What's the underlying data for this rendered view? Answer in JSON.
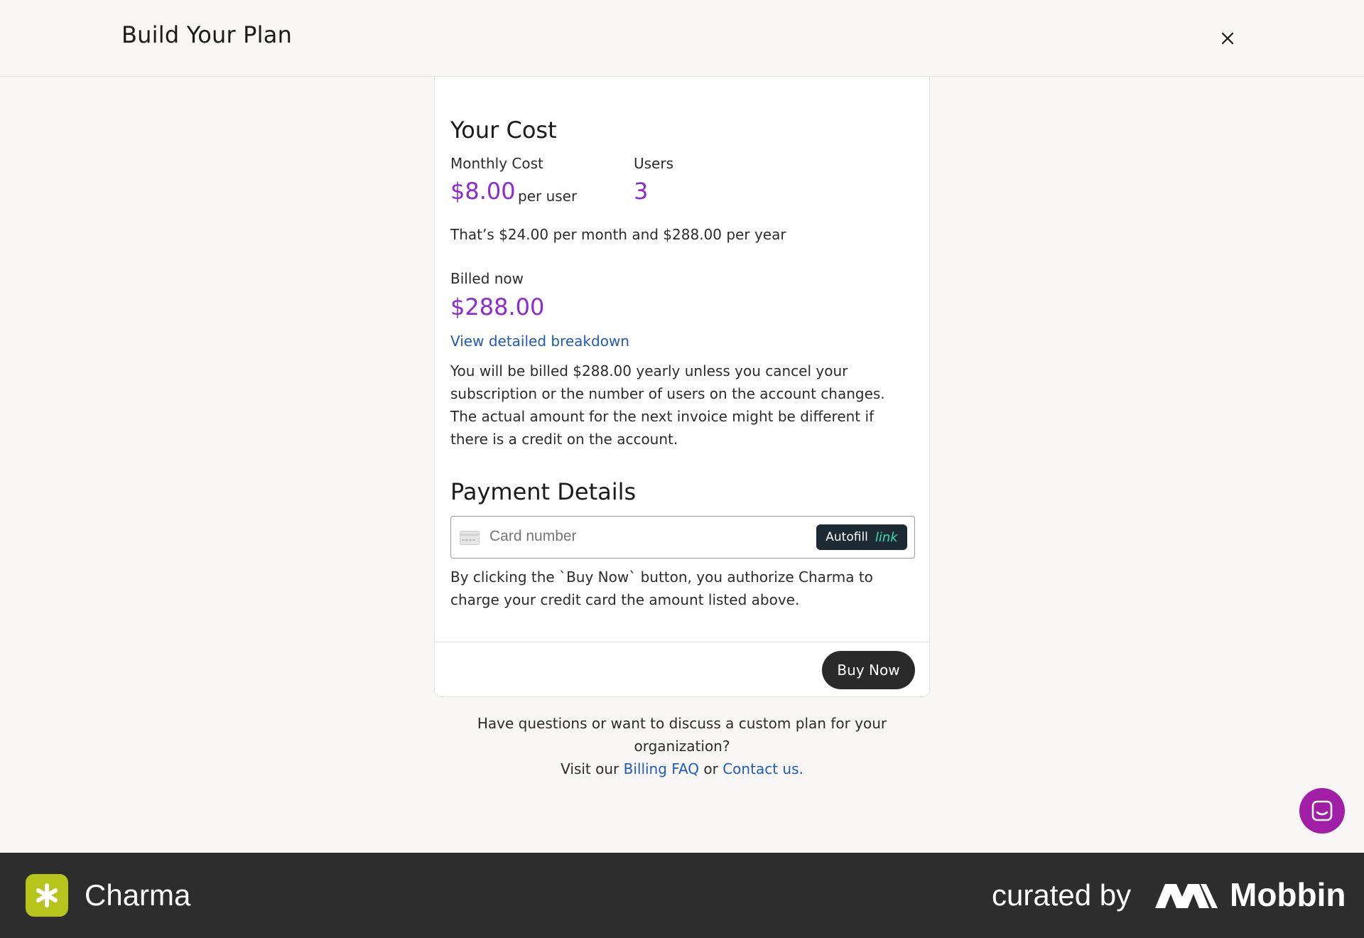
{
  "header": {
    "title": "Build Your Plan",
    "close_icon": "close-icon"
  },
  "cost": {
    "heading": "Your Cost",
    "monthly_label": "Monthly Cost",
    "monthly_value": "$8.00",
    "per_user": "per user",
    "users_label": "Users",
    "users_value": "3",
    "summary": "That’s $24.00 per month and $288.00 per year",
    "billed_label": "Billed now",
    "billed_value": "$288.00",
    "breakdown_link": "View detailed breakdown",
    "billing_note": "You will be billed $288.00 yearly unless you cancel your subscription or the number of users on the account changes. The actual amount for the next invoice might be different if there is a credit on the account."
  },
  "payment": {
    "heading": "Payment Details",
    "card_placeholder": "Card number",
    "card_icon": "credit-card-icon",
    "autofill_label": "Autofill",
    "autofill_brand": "link",
    "authorization": "By clicking the `Buy Now` button, you authorize Charma to charge your credit card the amount listed above.",
    "buy_button": "Buy Now"
  },
  "faq": {
    "line1": "Have questions or want to discuss a custom plan for your organization?",
    "prefix": "Visit our",
    "billing_faq": "Billing FAQ",
    "or": "or",
    "contact": "Contact us."
  },
  "chat": {
    "icon": "chat-icon"
  },
  "footer": {
    "brand": "Charma",
    "curated_by": "curated by",
    "mobbin": "Mobbin"
  },
  "colors": {
    "accent_purple": "#8a2bd6",
    "link_blue": "#1f5bb8",
    "chat_magenta": "#a11fa6",
    "brand_lime": "#b6c41c"
  }
}
